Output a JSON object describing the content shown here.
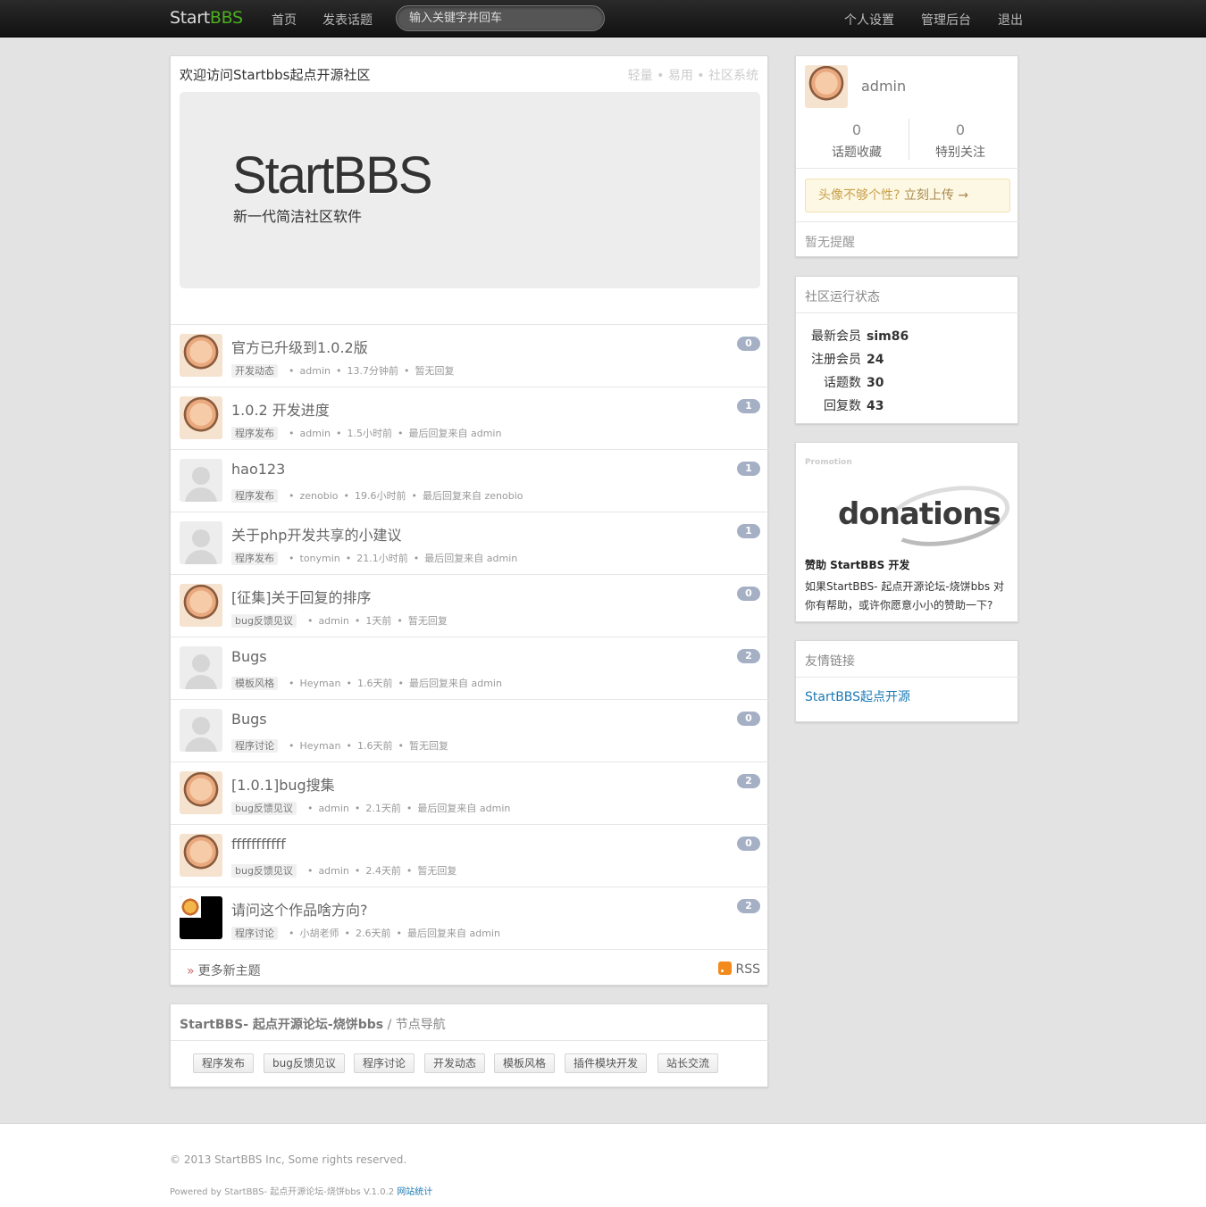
{
  "nav": {
    "brand_start": "Start",
    "brand_bbs": "BBS",
    "home": "首页",
    "new_topic": "发表话题",
    "search_placeholder": "输入关键字并回车",
    "settings": "个人设置",
    "admin": "管理后台",
    "logout": "退出"
  },
  "welcome": {
    "title": "欢迎访问Startbbs起点开源社区",
    "tagline": "轻量 • 易用 • 社区系统",
    "banner_logo": "StartBBS",
    "banner_sub": "新一代简洁社区软件"
  },
  "topics": [
    {
      "title": "官方已升级到1.0.2版",
      "node": "开发动态",
      "author": "admin",
      "time": "13.7分钟前",
      "last": "暂无回复",
      "replies": "0",
      "avatar": "baby"
    },
    {
      "title": "1.0.2 开发进度",
      "node": "程序发布",
      "author": "admin",
      "time": "1.5小时前",
      "last": "最后回复来自 admin",
      "replies": "1",
      "avatar": "baby"
    },
    {
      "title": "hao123",
      "node": "程序发布",
      "author": "zenobio",
      "time": "19.6小时前",
      "last": "最后回复来自 zenobio",
      "replies": "1",
      "avatar": "default"
    },
    {
      "title": "关于php开发共享的小建议",
      "node": "程序发布",
      "author": "tonymin",
      "time": "21.1小时前",
      "last": "最后回复来自 admin",
      "replies": "1",
      "avatar": "default"
    },
    {
      "title": "[征集]关于回复的排序",
      "node": "bug反馈见议",
      "author": "admin",
      "time": "1天前",
      "last": "暂无回复",
      "replies": "0",
      "avatar": "baby"
    },
    {
      "title": "Bugs",
      "node": "模板风格",
      "author": "Heyman",
      "time": "1.6天前",
      "last": "最后回复来自 admin",
      "replies": "2",
      "avatar": "default"
    },
    {
      "title": "Bugs",
      "node": "程序讨论",
      "author": "Heyman",
      "time": "1.6天前",
      "last": "暂无回复",
      "replies": "0",
      "avatar": "default"
    },
    {
      "title": "[1.0.1]bug搜集",
      "node": "bug反馈见议",
      "author": "admin",
      "time": "2.1天前",
      "last": "最后回复来自 admin",
      "replies": "2",
      "avatar": "baby"
    },
    {
      "title": "fffffffffff",
      "node": "bug反馈见议",
      "author": "admin",
      "time": "2.4天前",
      "last": "暂无回复",
      "replies": "0",
      "avatar": "baby"
    },
    {
      "title": "请问这个作品啥方向?",
      "node": "程序讨论",
      "author": "小胡老师",
      "time": "2.6天前",
      "last": "最后回复来自 admin",
      "replies": "2",
      "avatar": "black"
    }
  ],
  "more": {
    "label": "更多新主题",
    "raquo": "»",
    "rss": "RSS"
  },
  "node_nav": {
    "site": "StartBBS- 起点开源论坛-烧饼bbs",
    "sep": " / ",
    "title": "节点导航",
    "tags": [
      "程序发布",
      "bug反馈见议",
      "程序讨论",
      "开发动态",
      "模板风格",
      "插件模块开发",
      "站长交流"
    ]
  },
  "user": {
    "name": "admin",
    "fav_count": "0",
    "fav_label": "话题收藏",
    "follow_count": "0",
    "follow_label": "特别关注",
    "upload_text": "头像不够个性?",
    "upload_link": "立刻上传 →",
    "no_remind": "暂无提醒"
  },
  "stats": {
    "title": "社区运行状态",
    "rows": [
      {
        "label": "最新会员",
        "value": "sim86"
      },
      {
        "label": "注册会员",
        "value": "24"
      },
      {
        "label": "话题数",
        "value": "30"
      },
      {
        "label": "回复数",
        "value": "43"
      }
    ]
  },
  "promo": {
    "label": "Promotion",
    "image_text": "donations",
    "title": "赞助 StartBBS 开发",
    "text": "如果StartBBS- 起点开源论坛-烧饼bbs 对你有帮助，或许你愿意小小的赞助一下?"
  },
  "links": {
    "title": "友情链接",
    "item": "StartBBS起点开源"
  },
  "footer": {
    "copyright": "© 2013 StartBBS Inc, Some rights reserved.",
    "powered": "Powered by StartBBS- 起点开源论坛-烧饼bbs V.1.0.2",
    "stat_link": "网站统计"
  },
  "colors": {
    "brand_green": "#4caf1e",
    "badge": "#a5b0c5",
    "link_blue": "#1a7ab5"
  }
}
